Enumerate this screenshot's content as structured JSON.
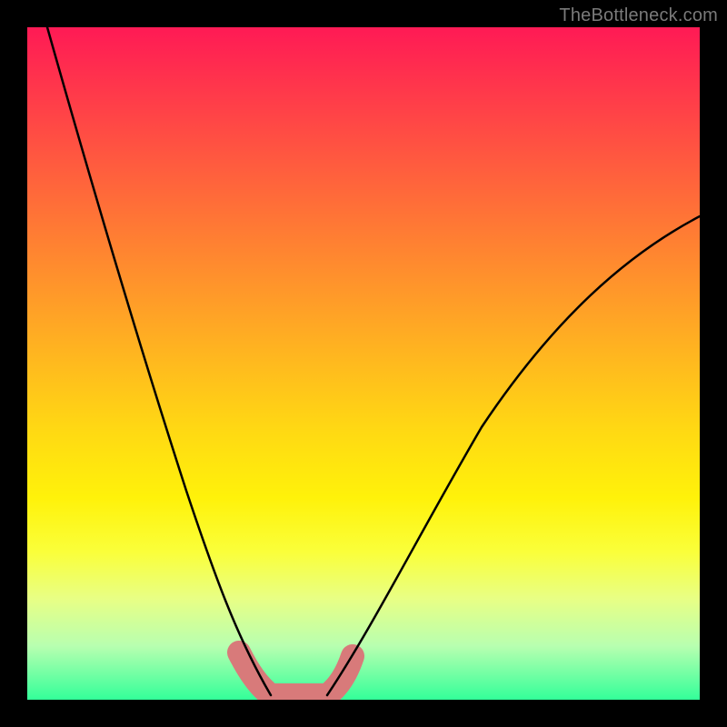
{
  "watermark": {
    "text": "TheBottleneck.com"
  },
  "chart_data": {
    "type": "line",
    "title": "",
    "xlabel": "",
    "ylabel": "",
    "xlim": [
      0,
      100
    ],
    "ylim": [
      0,
      100
    ],
    "background_gradient": {
      "top": "#ff1a55",
      "mid": "#fff20a",
      "bottom": "#33ff99"
    },
    "series": [
      {
        "name": "left-curve",
        "stroke": "#000000",
        "x": [
          2,
          5,
          10,
          15,
          20,
          25,
          30,
          33,
          35,
          37
        ],
        "values": [
          100,
          88,
          71,
          56,
          42,
          28,
          15,
          7,
          3,
          0
        ]
      },
      {
        "name": "right-curve",
        "stroke": "#000000",
        "x": [
          45,
          47,
          50,
          55,
          60,
          65,
          70,
          80,
          90,
          100
        ],
        "values": [
          0,
          3,
          8,
          17,
          26,
          35,
          43,
          56,
          65,
          72
        ]
      },
      {
        "name": "valley-highlight",
        "stroke": "#d87a7a",
        "stroke_width": 14,
        "x": [
          33,
          35,
          37,
          45,
          47
        ],
        "values": [
          7,
          3,
          0,
          0,
          3
        ]
      }
    ],
    "optimal_range_x": [
      37,
      45
    ]
  }
}
